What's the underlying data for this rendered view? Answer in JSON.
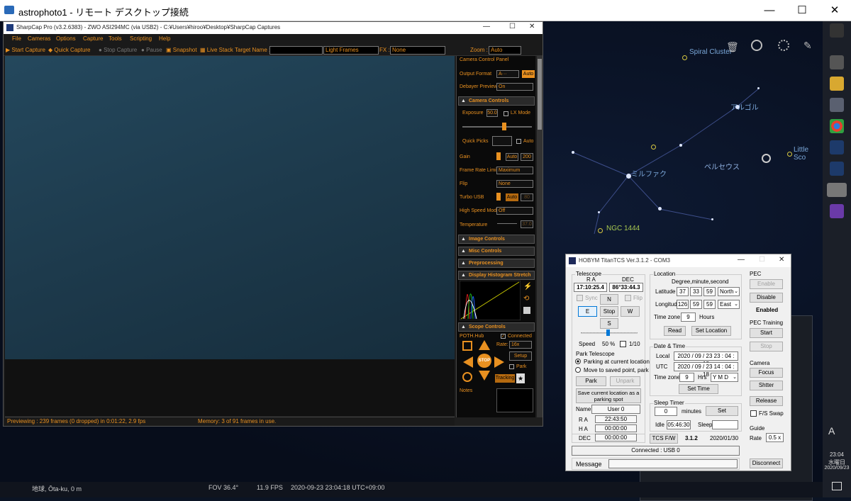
{
  "remote": {
    "title": "astrophoto1 - リモート デスクトップ接続"
  },
  "sky": {
    "labels": {
      "spiral": "Spiral Cluster",
      "algol": "アルゴル",
      "little": "Little Sco",
      "mirfak": "ミルファク",
      "perseus": "ペルセウス",
      "ngc": "NGC 1444"
    }
  },
  "sharpcap": {
    "title": "SharpCap Pro (v3.2.6383) - ZWO ASI294MC (via USB2) - C:¥Users¥hiroo¥Desktop¥SharpCap Captures",
    "menu": [
      "File",
      "Cameras",
      "Options",
      "Capture",
      "Tools",
      "Scripting",
      "Help"
    ],
    "toolbar": {
      "start": "Start Capture",
      "quick": "Quick Capture",
      "stop": "Stop Capture",
      "pause": "Pause",
      "snapshot": "Snapshot",
      "live": "Live Stack",
      "target_label": "Target Name :",
      "frame_type": "Light Frames",
      "fx_label": "FX :",
      "fx_value": "None",
      "zoom_label": "Zoom :",
      "zoom_value": "Auto"
    },
    "status": {
      "preview": "Previewing : 239 frames (0 dropped) in 0:01:22, 2.9 fps",
      "memory": "Memory: 3 of 91 frames in use."
    },
    "panel": {
      "title": "Camera Control Panel",
      "output_format": "Output Format",
      "output_value": "A···",
      "auto": "Auto",
      "debayer": "Debayer Preview",
      "debayer_value": "On",
      "camera_controls": "Camera Controls",
      "exposure": "Exposure",
      "exposure_value": "50.0",
      "lx": "LX Mode",
      "quick_picks": "Quick Picks",
      "qp_auto": "Auto",
      "gain": "Gain",
      "gain_auto": "Auto",
      "gain_value": "200",
      "fps_limit": "Frame Rate Limit",
      "fps_limit_value": "Maximum",
      "flip": "Flip",
      "flip_value": "None",
      "turbo": "Turbo USB",
      "turbo_auto": "Auto",
      "turbo_value": "80",
      "hsm": "High Speed Mode",
      "hsm_value": "Off",
      "temp": "Temperature",
      "temp_value": "37.0",
      "image_controls": "Image Controls",
      "misc_controls": "Misc Controls",
      "preprocessing": "Preprocessing",
      "histogram": "Display Histogram Stretch",
      "scope_controls": "Scope Controls",
      "hub": "POTH.Hub",
      "connected": "Connected",
      "rate": "Rate:",
      "rate_value": "16x",
      "setup": "Setup",
      "park": "Park",
      "stop": "STOP",
      "tracking": "Tracking",
      "notes": "Notes"
    }
  },
  "tcs": {
    "title": "HOBYM TitanTCS Ver.3.1.2 - COM3",
    "telescope": "Telescope",
    "ra_lbl": "R A",
    "dec_lbl": "DEC",
    "ra": "17:10:25.4",
    "dec": "86°33:44.3",
    "sync": "Sync",
    "flip": "Flip",
    "n": "N",
    "e": "E",
    "stop": "Stop",
    "w": "W",
    "s": "S",
    "speed": "Speed",
    "speed_val": "50 %",
    "speed_frac": "1/10",
    "park_telescope": "Park Telescope",
    "park_opt1": "Parking at current location",
    "park_opt2": "Move to saved point, park",
    "park_btn": "Park",
    "unpark_btn": "Unpark",
    "save_loc": "Save current location as a parking spot",
    "name_lbl": "Name",
    "name_val": "User 0",
    "ra2_lbl": "R A",
    "ra2": "22:43:50",
    "ha_lbl": "H A",
    "ha": "00:00:00",
    "dec2_lbl": "DEC",
    "dec2": "00:00:00",
    "location": "Location",
    "dms": "Degree,minute,second",
    "lat_lbl": "Latitude",
    "lat_d": "37",
    "lat_m": "33",
    "lat_s": "59",
    "lat_dir": "North",
    "lon_lbl": "Longitude",
    "lon_d": "126",
    "lon_m": "59",
    "lon_s": "59",
    "lon_dir": "East",
    "tz_lbl": "Time zone",
    "tz": "9",
    "hours": "Hours",
    "read": "Read",
    "set_loc": "Set Location",
    "datetime": "Date & Time",
    "local_lbl": "Local",
    "local": "2020 / 09 / 23  23 : 04 : 18",
    "utc_lbl": "UTC",
    "utc": "2020 / 09 / 23  14 : 04 : 18",
    "tz2_lbl": "Time zone",
    "tz2": "9",
    "hrs": "Hrs",
    "ymd": "Y M D",
    "set_time": "Set Time",
    "sleep": "Sleep Timer",
    "minutes_val": "0",
    "minutes": "minutes",
    "set": "Set",
    "idle_lbl": "Idle",
    "idle": "05:46:30",
    "sleep_lbl": "Sleep",
    "tcsfw": "TCS F/W",
    "fw_ver": "3.1.2",
    "fw_date": "2020/01/30",
    "pec": "PEC",
    "enable": "Enable",
    "disable": "Disable",
    "enabled": "Enabled",
    "pec_train": "PEC Training",
    "start": "Start",
    "stop2": "Stop",
    "camera": "Camera",
    "focus": "Focus",
    "shutter": "Shtter",
    "release": "Release",
    "fs_swap": "F/S Swap",
    "guide": "Guide",
    "guide_rate_lbl": "Rate",
    "guide_rate": "0.5 x",
    "connected": "Connected : USB 0",
    "message": "Message",
    "disconnect": "Disconnect"
  },
  "infobar": {
    "location": "地球, Ōta-ku, 0 m",
    "fov": "FOV 36.4°",
    "fps": "11.9 FPS",
    "datetime": "2020-09-23 23:04:18 UTC+09:00"
  },
  "clock": {
    "time": "23:04",
    "day": "水曜日",
    "date": "2020/09/23"
  }
}
